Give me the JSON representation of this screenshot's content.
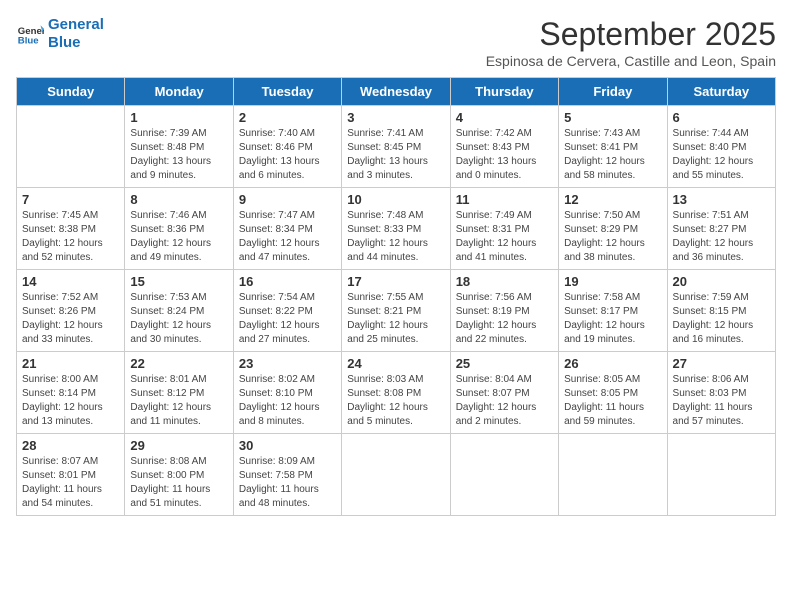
{
  "logo": {
    "line1": "General",
    "line2": "Blue"
  },
  "title": "September 2025",
  "subtitle": "Espinosa de Cervera, Castille and Leon, Spain",
  "days_of_week": [
    "Sunday",
    "Monday",
    "Tuesday",
    "Wednesday",
    "Thursday",
    "Friday",
    "Saturday"
  ],
  "weeks": [
    [
      {
        "day": "",
        "info": ""
      },
      {
        "day": "1",
        "info": "Sunrise: 7:39 AM\nSunset: 8:48 PM\nDaylight: 13 hours\nand 9 minutes."
      },
      {
        "day": "2",
        "info": "Sunrise: 7:40 AM\nSunset: 8:46 PM\nDaylight: 13 hours\nand 6 minutes."
      },
      {
        "day": "3",
        "info": "Sunrise: 7:41 AM\nSunset: 8:45 PM\nDaylight: 13 hours\nand 3 minutes."
      },
      {
        "day": "4",
        "info": "Sunrise: 7:42 AM\nSunset: 8:43 PM\nDaylight: 13 hours\nand 0 minutes."
      },
      {
        "day": "5",
        "info": "Sunrise: 7:43 AM\nSunset: 8:41 PM\nDaylight: 12 hours\nand 58 minutes."
      },
      {
        "day": "6",
        "info": "Sunrise: 7:44 AM\nSunset: 8:40 PM\nDaylight: 12 hours\nand 55 minutes."
      }
    ],
    [
      {
        "day": "7",
        "info": "Sunrise: 7:45 AM\nSunset: 8:38 PM\nDaylight: 12 hours\nand 52 minutes."
      },
      {
        "day": "8",
        "info": "Sunrise: 7:46 AM\nSunset: 8:36 PM\nDaylight: 12 hours\nand 49 minutes."
      },
      {
        "day": "9",
        "info": "Sunrise: 7:47 AM\nSunset: 8:34 PM\nDaylight: 12 hours\nand 47 minutes."
      },
      {
        "day": "10",
        "info": "Sunrise: 7:48 AM\nSunset: 8:33 PM\nDaylight: 12 hours\nand 44 minutes."
      },
      {
        "day": "11",
        "info": "Sunrise: 7:49 AM\nSunset: 8:31 PM\nDaylight: 12 hours\nand 41 minutes."
      },
      {
        "day": "12",
        "info": "Sunrise: 7:50 AM\nSunset: 8:29 PM\nDaylight: 12 hours\nand 38 minutes."
      },
      {
        "day": "13",
        "info": "Sunrise: 7:51 AM\nSunset: 8:27 PM\nDaylight: 12 hours\nand 36 minutes."
      }
    ],
    [
      {
        "day": "14",
        "info": "Sunrise: 7:52 AM\nSunset: 8:26 PM\nDaylight: 12 hours\nand 33 minutes."
      },
      {
        "day": "15",
        "info": "Sunrise: 7:53 AM\nSunset: 8:24 PM\nDaylight: 12 hours\nand 30 minutes."
      },
      {
        "day": "16",
        "info": "Sunrise: 7:54 AM\nSunset: 8:22 PM\nDaylight: 12 hours\nand 27 minutes."
      },
      {
        "day": "17",
        "info": "Sunrise: 7:55 AM\nSunset: 8:21 PM\nDaylight: 12 hours\nand 25 minutes."
      },
      {
        "day": "18",
        "info": "Sunrise: 7:56 AM\nSunset: 8:19 PM\nDaylight: 12 hours\nand 22 minutes."
      },
      {
        "day": "19",
        "info": "Sunrise: 7:58 AM\nSunset: 8:17 PM\nDaylight: 12 hours\nand 19 minutes."
      },
      {
        "day": "20",
        "info": "Sunrise: 7:59 AM\nSunset: 8:15 PM\nDaylight: 12 hours\nand 16 minutes."
      }
    ],
    [
      {
        "day": "21",
        "info": "Sunrise: 8:00 AM\nSunset: 8:14 PM\nDaylight: 12 hours\nand 13 minutes."
      },
      {
        "day": "22",
        "info": "Sunrise: 8:01 AM\nSunset: 8:12 PM\nDaylight: 12 hours\nand 11 minutes."
      },
      {
        "day": "23",
        "info": "Sunrise: 8:02 AM\nSunset: 8:10 PM\nDaylight: 12 hours\nand 8 minutes."
      },
      {
        "day": "24",
        "info": "Sunrise: 8:03 AM\nSunset: 8:08 PM\nDaylight: 12 hours\nand 5 minutes."
      },
      {
        "day": "25",
        "info": "Sunrise: 8:04 AM\nSunset: 8:07 PM\nDaylight: 12 hours\nand 2 minutes."
      },
      {
        "day": "26",
        "info": "Sunrise: 8:05 AM\nSunset: 8:05 PM\nDaylight: 11 hours\nand 59 minutes."
      },
      {
        "day": "27",
        "info": "Sunrise: 8:06 AM\nSunset: 8:03 PM\nDaylight: 11 hours\nand 57 minutes."
      }
    ],
    [
      {
        "day": "28",
        "info": "Sunrise: 8:07 AM\nSunset: 8:01 PM\nDaylight: 11 hours\nand 54 minutes."
      },
      {
        "day": "29",
        "info": "Sunrise: 8:08 AM\nSunset: 8:00 PM\nDaylight: 11 hours\nand 51 minutes."
      },
      {
        "day": "30",
        "info": "Sunrise: 8:09 AM\nSunset: 7:58 PM\nDaylight: 11 hours\nand 48 minutes."
      },
      {
        "day": "",
        "info": ""
      },
      {
        "day": "",
        "info": ""
      },
      {
        "day": "",
        "info": ""
      },
      {
        "day": "",
        "info": ""
      }
    ]
  ]
}
